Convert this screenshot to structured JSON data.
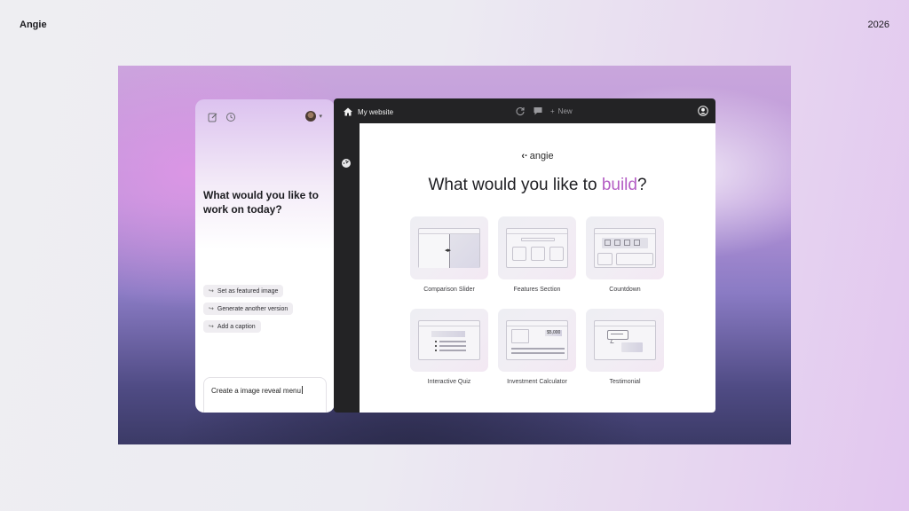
{
  "page": {
    "brand": "Angie",
    "year": "2026"
  },
  "chat": {
    "top_icons": [
      "compose-icon",
      "history-icon"
    ],
    "title": "What would you like to work on today?",
    "suggestions": [
      "Set as featured image",
      "Generate another version",
      "Add a caption"
    ],
    "input_value": "Create a image reveal menu"
  },
  "editor": {
    "site_name": "My website",
    "new_label": "New",
    "logo": "angie",
    "logo_mark": "‹·",
    "headline_prefix": "What would you like to ",
    "headline_highlight": "build",
    "headline_suffix": "?",
    "cards": [
      {
        "label": "Comparison Slider"
      },
      {
        "label": "Features Section"
      },
      {
        "label": "Countdown"
      },
      {
        "label": "Interactive Quiz"
      },
      {
        "label": "Investment Calculator"
      },
      {
        "label": "Testimonial"
      }
    ],
    "calc_value": "$5,000"
  },
  "colors": {
    "accent": "#b45dc4",
    "editor_bg": "#232325"
  }
}
